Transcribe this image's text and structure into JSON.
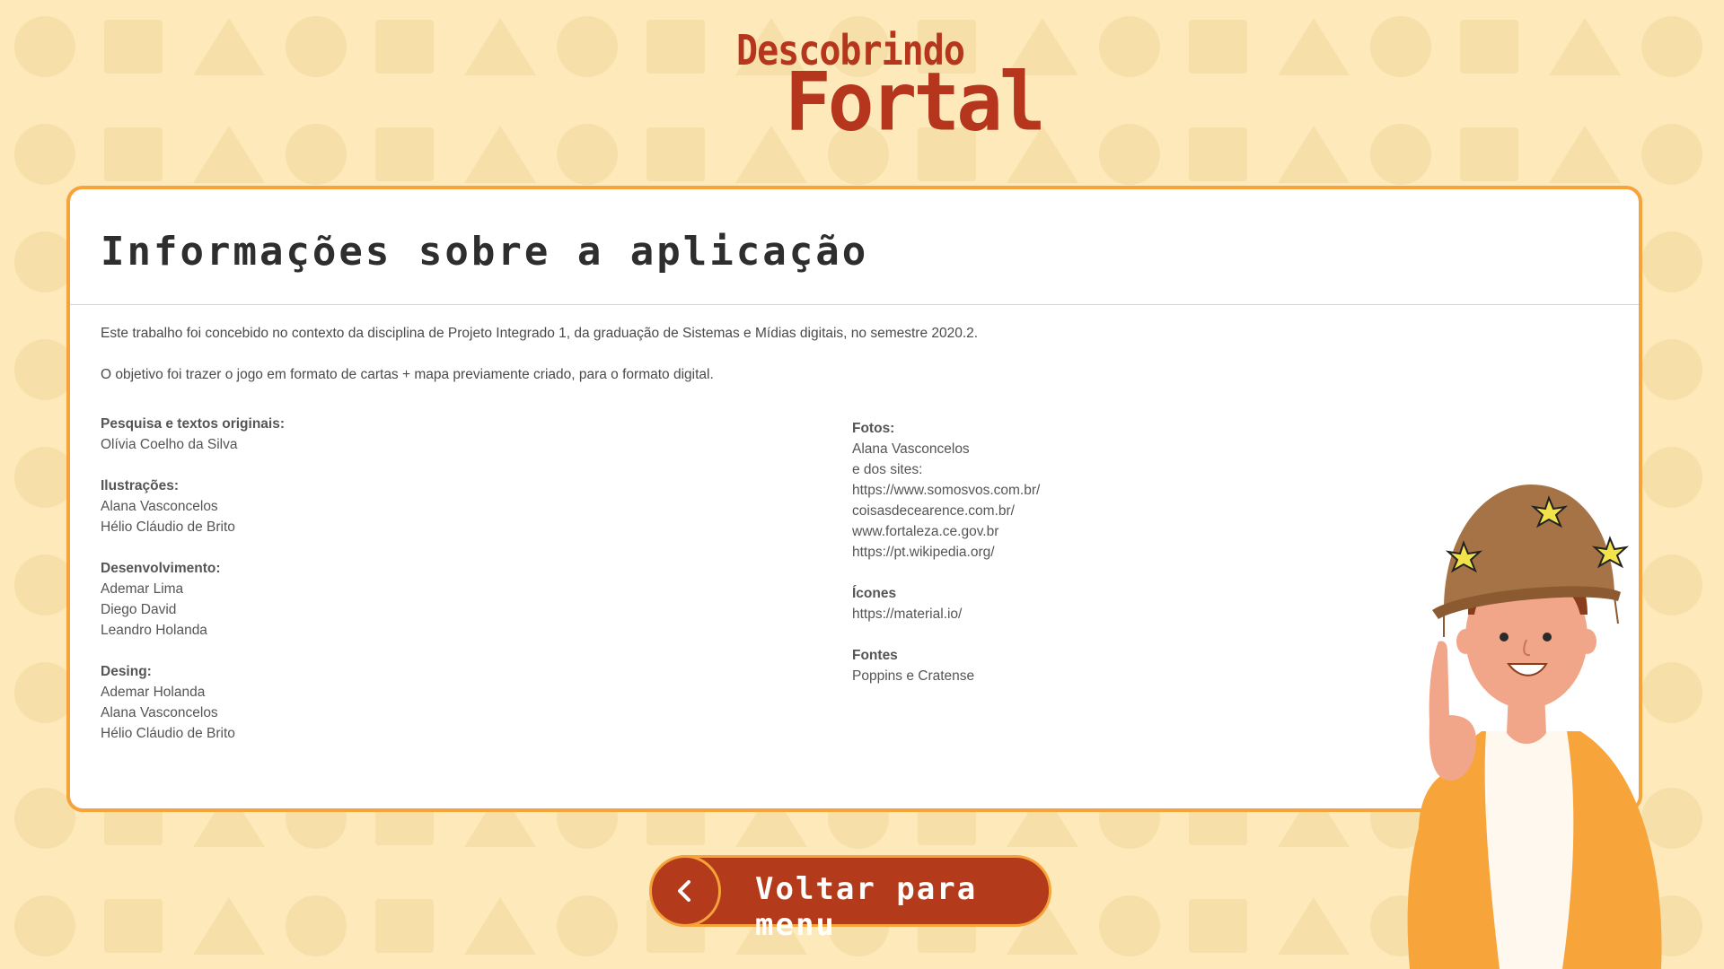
{
  "logo": {
    "line1": "Descobrindo",
    "line2": "Fortal"
  },
  "card": {
    "title": "Informações sobre a aplicação",
    "intro1": "Este trabalho foi concebido no contexto da disciplina de Projeto Integrado 1, da graduação de Sistemas e Mídias digitais, no semestre 2020.2.",
    "intro2": "O objetivo foi trazer o jogo em formato de cartas + mapa previamente criado, para o formato digital.",
    "left_column": [
      {
        "title": "Pesquisa e textos originais:",
        "lines": [
          "Olívia Coelho da Silva"
        ]
      },
      {
        "title": "Ilustrações:",
        "lines": [
          "Alana Vasconcelos",
          "Hélio Cláudio de Brito"
        ]
      },
      {
        "title": "Desenvolvimento:",
        "lines": [
          "Ademar Lima",
          "Diego David",
          "Leandro Holanda"
        ]
      },
      {
        "title": "Desing:",
        "lines": [
          "Ademar Holanda",
          "Alana Vasconcelos",
          "Hélio Cláudio de Brito"
        ]
      }
    ],
    "right_column": [
      {
        "title": "Fotos:",
        "lines": [
          "Alana Vasconcelos",
          "e dos sites:",
          "https://www.somosvos.com.br/",
          "coisasdecearence.com.br/",
          "www.fortaleza.ce.gov.br",
          "https://pt.wikipedia.org/"
        ]
      },
      {
        "title": "Ícones",
        "lines": [
          "https://material.io/"
        ]
      },
      {
        "title": "Fontes",
        "lines": [
          "Poppins e Cratense"
        ]
      }
    ]
  },
  "back_button": {
    "label": "Voltar para menu",
    "icon": "chevron-left-icon"
  },
  "colors": {
    "background": "#fde9ba",
    "accent": "#f5a33a",
    "brand": "#b5361c",
    "button": "#b33a1a"
  }
}
